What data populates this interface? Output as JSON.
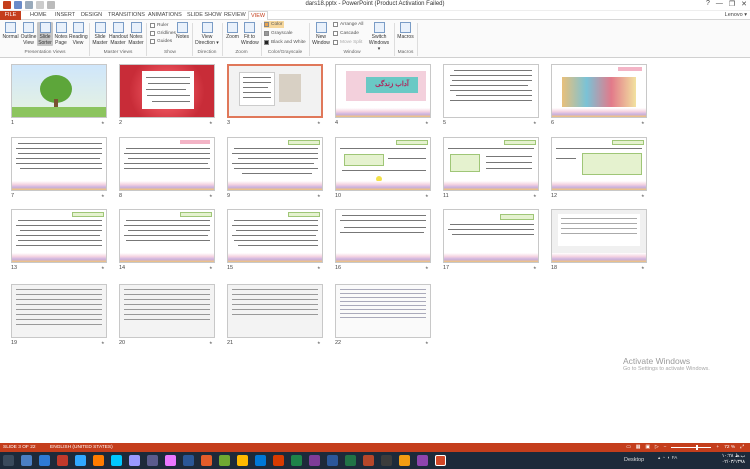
{
  "window": {
    "title": "dars18.pptx - PowerPoint (Product Activation Failed)",
    "controls": [
      "?",
      "—",
      "❐",
      "✕"
    ]
  },
  "tabs": {
    "file": "FILE",
    "items": [
      "HOME",
      "INSERT",
      "DESIGN",
      "TRANSITIONS",
      "ANIMATIONS",
      "SLIDE SHOW",
      "REVIEW",
      "VIEW"
    ],
    "active": "VIEW",
    "user": "Lenovo ▾"
  },
  "ribbon": {
    "presentation_views": {
      "label": "Presentation Views",
      "buttons": [
        "Normal",
        "Outline View",
        "Slide Sorter",
        "Notes Page",
        "Reading View"
      ]
    },
    "master_views": {
      "label": "Master Views",
      "buttons": [
        "Slide Master",
        "Handout Master",
        "Notes Master"
      ]
    },
    "show": {
      "label": "Show",
      "items": [
        "Ruler",
        "Gridlines",
        "Guides"
      ]
    },
    "notes_item": "Notes",
    "direction": {
      "label": "Direction",
      "button": "View Direction ▾"
    },
    "zoom": {
      "label": "Zoom",
      "buttons": [
        "Zoom",
        "Fit to Window"
      ]
    },
    "color": {
      "label": "Color/Grayscale",
      "items": [
        "Color",
        "Grayscale",
        "Black and White"
      ]
    },
    "window": {
      "label": "Window",
      "new_window": "New Window",
      "items": [
        "Arrange All",
        "Cascade",
        "Move Split"
      ]
    },
    "switch": "Switch Windows ▾",
    "macros": {
      "label": "Macros",
      "button": "Macros"
    }
  },
  "slides": [
    {
      "num": "1"
    },
    {
      "num": "2"
    },
    {
      "num": "3"
    },
    {
      "num": "4"
    },
    {
      "num": "5"
    },
    {
      "num": "6"
    },
    {
      "num": "7"
    },
    {
      "num": "8"
    },
    {
      "num": "9"
    },
    {
      "num": "10"
    },
    {
      "num": "11"
    },
    {
      "num": "12"
    },
    {
      "num": "13"
    },
    {
      "num": "14"
    },
    {
      "num": "15"
    },
    {
      "num": "16"
    },
    {
      "num": "17"
    },
    {
      "num": "18"
    },
    {
      "num": "19"
    },
    {
      "num": "20"
    },
    {
      "num": "21"
    },
    {
      "num": "22"
    }
  ],
  "selected_slide": 3,
  "slide4_title": "آداب زندگی",
  "activation": {
    "line1": "Activate Windows",
    "line2": "Go to Settings to activate Windows."
  },
  "status": {
    "slide_count": "SLIDE 3 OF 22",
    "language": "ENGLISH (UNITED STATES)",
    "zoom": "72 %"
  },
  "taskbar": {
    "desktop": "Desktop",
    "lang": "FA",
    "time": "۱۰:۲۸ ب.ظ",
    "date": "۰۲/۰۳/۱۳۹۸"
  },
  "colors": {
    "accent": "#c43e1c",
    "selection": "#e0785a",
    "taskbar": "#1d2a3a"
  }
}
